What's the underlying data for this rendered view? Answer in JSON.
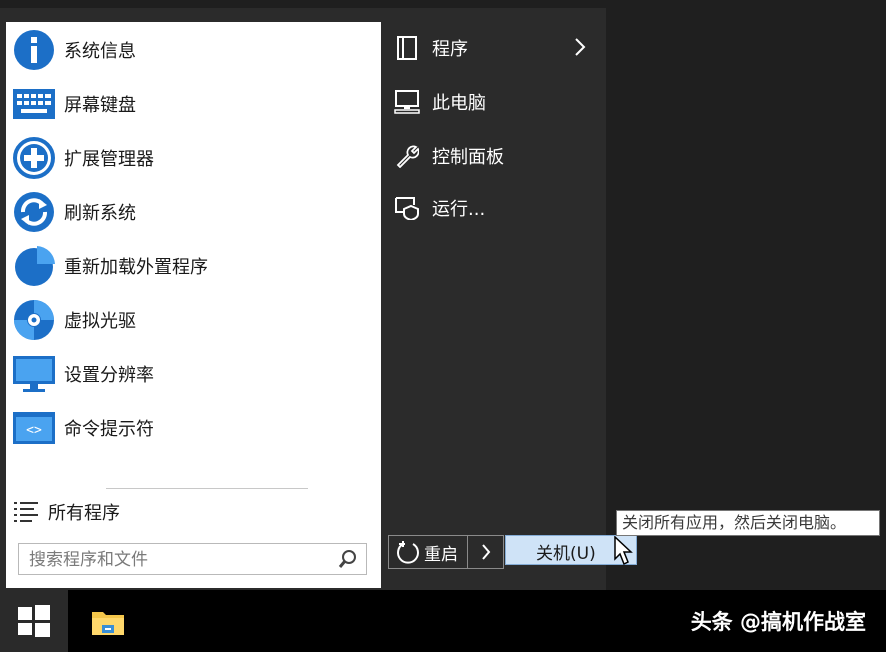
{
  "left_panel": {
    "items": [
      {
        "label": "系统信息",
        "icon": "info-icon"
      },
      {
        "label": "屏幕键盘",
        "icon": "keyboard-icon"
      },
      {
        "label": "扩展管理器",
        "icon": "plus-circle-icon"
      },
      {
        "label": "刷新系统",
        "icon": "refresh-icon"
      },
      {
        "label": "重新加载外置程序",
        "icon": "pie-icon"
      },
      {
        "label": "虚拟光驱",
        "icon": "disc-icon"
      },
      {
        "label": "设置分辨率",
        "icon": "monitor-icon"
      },
      {
        "label": "命令提示符",
        "icon": "terminal-icon"
      }
    ],
    "all_programs": "所有程序",
    "search_placeholder": "搜索程序和文件"
  },
  "right_panel": {
    "items": [
      {
        "label": "程序",
        "icon": "document-icon"
      },
      {
        "label": "此电脑",
        "icon": "computer-icon"
      },
      {
        "label": "控制面板",
        "icon": "wrench-icon"
      },
      {
        "label": "运行...",
        "icon": "run-icon"
      }
    ]
  },
  "power": {
    "restart_label": "重启",
    "menu_item": "关机(U)",
    "tooltip": "关闭所有应用，然后关闭电脑。"
  },
  "taskbar": {
    "watermark": "头条 @搞机作战室"
  },
  "colors": {
    "icon_blue": "#1c6fc7",
    "icon_light_blue": "#4aa3f0",
    "menu_highlight": "#cfe3f7"
  }
}
